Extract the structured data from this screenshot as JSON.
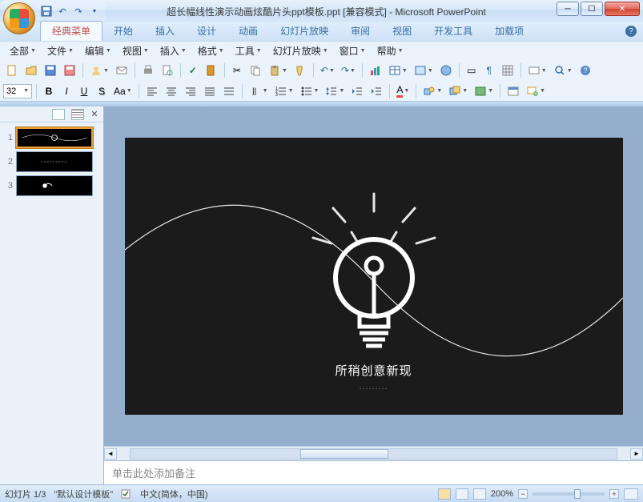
{
  "titlebar": {
    "title": "超长幅线性演示动画炫酷片头ppt模板.ppt [兼容模式] - Microsoft PowerPoint"
  },
  "ribbon_tabs": [
    "经典菜单",
    "开始",
    "插入",
    "设计",
    "动画",
    "幻灯片放映",
    "审阅",
    "视图",
    "开发工具",
    "加载项"
  ],
  "active_tab_index": 0,
  "menus": [
    "全部",
    "文件",
    "编辑",
    "视图",
    "插入",
    "格式",
    "工具",
    "幻灯片放映",
    "窗口",
    "帮助"
  ],
  "fontsize": "32",
  "slides": [
    {
      "num": "1"
    },
    {
      "num": "2"
    },
    {
      "num": "3"
    }
  ],
  "active_slide_index": 0,
  "slide_content": {
    "line1": "所稍创意新现",
    "line2": "·········"
  },
  "notes_placeholder": "单击此处添加备注",
  "status": {
    "slide_counter": "幻灯片 1/3",
    "template": "\"默认设计模板\"",
    "language": "中文(简体，中国)",
    "zoom": "200%"
  }
}
